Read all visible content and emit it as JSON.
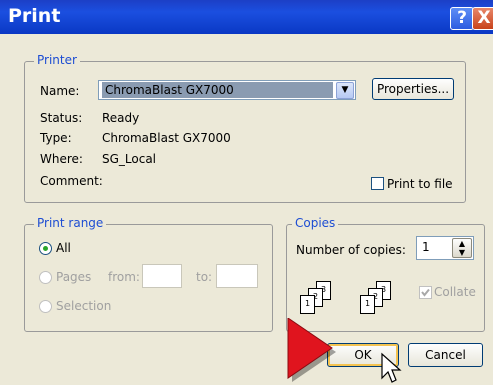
{
  "window": {
    "title": "Print",
    "help_label": "?",
    "close_label": "X"
  },
  "printer": {
    "group_label": "Printer",
    "name_label": "Name:",
    "name_value": "ChromaBlast GX7000",
    "properties_label": "Properties...",
    "status_label": "Status:",
    "status_value": "Ready",
    "type_label": "Type:",
    "type_value": "ChromaBlast GX7000",
    "where_label": "Where:",
    "where_value": "SG_Local",
    "comment_label": "Comment:",
    "print_to_file_label": "Print to file"
  },
  "print_range": {
    "group_label": "Print range",
    "all_label": "All",
    "pages_label": "Pages",
    "from_label": "from:",
    "to_label": "to:",
    "selection_label": "Selection"
  },
  "copies": {
    "group_label": "Copies",
    "number_label": "Number of copies:",
    "number_value": "1",
    "collate_label": "Collate",
    "page_numbers": [
      "1",
      "2",
      "3"
    ]
  },
  "buttons": {
    "ok_label": "OK",
    "cancel_label": "Cancel"
  },
  "colors": {
    "titlebar": "#1b4fe0",
    "group_label": "#1d4dd3",
    "pointer_arrow": "#e0141e"
  }
}
